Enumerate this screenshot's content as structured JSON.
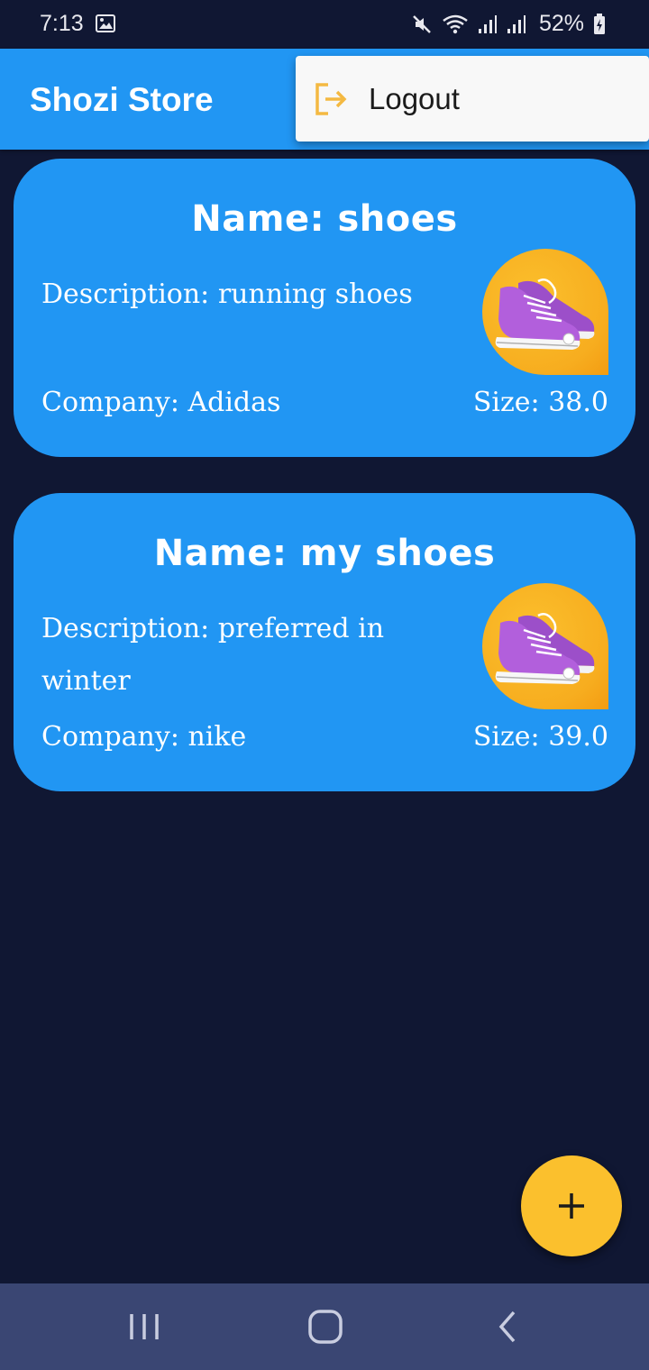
{
  "status_bar": {
    "time": "7:13",
    "battery": "52%"
  },
  "app_bar": {
    "title": "Shozi Store"
  },
  "menu": {
    "logout_label": "Logout",
    "logout_icon": "logout-icon",
    "icon_color": "#f4b942"
  },
  "products": [
    {
      "name": "Name: shoes",
      "description": "Description: running shoes",
      "company": "Company: Adidas",
      "size": "Size: 38.0",
      "image_icon": "sneakers-image"
    },
    {
      "name": "Name: my shoes",
      "description": "Description: preferred in winter",
      "company": "Company: nike",
      "size": "Size: 39.0",
      "image_icon": "sneakers-image"
    }
  ],
  "fab": {
    "icon": "plus-icon",
    "color": "#fbc02d"
  },
  "colors": {
    "background": "#101733",
    "primary": "#2196f3",
    "accent": "#fbc02d",
    "nav_bar": "#3a4673"
  }
}
